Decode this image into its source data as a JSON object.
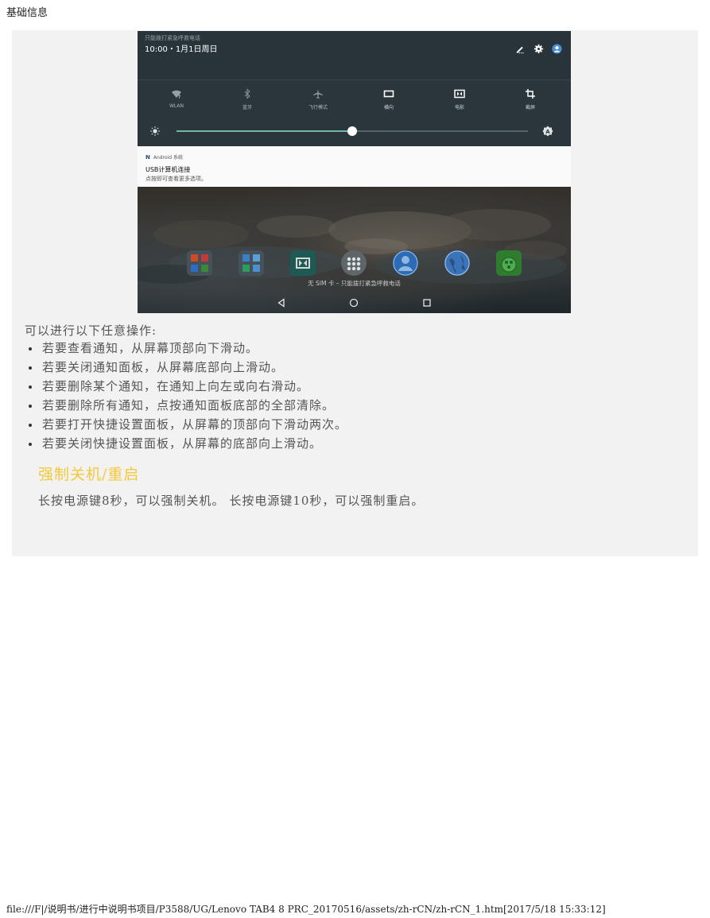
{
  "page_header": "基础信息",
  "screenshot": {
    "emergency_text": "只能拨打紧急呼救电话",
    "datetime": "10:00・1月1日周日",
    "top_icons": [
      "edit-icon",
      "gear-icon",
      "user-avatar-icon"
    ],
    "tiles": [
      {
        "label": "WLAN",
        "icon": "wifi-question-icon",
        "active": false
      },
      {
        "label": "蓝牙",
        "icon": "bluetooth-icon",
        "active": false
      },
      {
        "label": "飞行模式",
        "icon": "airplane-icon",
        "active": false
      },
      {
        "label": "横向",
        "icon": "landscape-icon",
        "active": true
      },
      {
        "label": "电影",
        "icon": "movie-icon",
        "active": true
      },
      {
        "label": "截屏",
        "icon": "crop-icon",
        "active": true
      }
    ],
    "brightness_level": 0.5,
    "notification": {
      "app": "Android 系统",
      "title": "USB计算机连接",
      "text": "点按即可查看更多选项。"
    },
    "dock_icons": [
      "office-folder-icon",
      "tools-folder-icon",
      "dolby-icon",
      "app-drawer-icon",
      "contacts-icon",
      "browser-icon",
      "security-icon"
    ],
    "sim_text": "无 SIM 卡 – 只能拨打紧急呼救电话",
    "nav_buttons": [
      "back-icon",
      "home-icon",
      "recents-icon"
    ],
    "colors": {
      "panel_dark": "#28343a",
      "slider_accent": "#6fb8a4"
    }
  },
  "intro": "可以进行以下任意操作:",
  "operations": [
    "若要查看通知，从屏幕顶部向下滑动。",
    "若要关闭通知面板，从屏幕底部向上滑动。",
    "若要删除某个通知，在通知上向左或向右滑动。",
    "若要删除所有通知，点按通知面板底部的全部清除。",
    "若要打开快捷设置面板，从屏幕的顶部向下滑动两次。",
    "若要关闭快捷设置面板，从屏幕的底部向上滑动。"
  ],
  "section": {
    "title": "强制关机/重启",
    "body": "长按电源键8秒，可以强制关机。 长按电源键10秒，可以强制重启。",
    "title_color": "#f4c93b"
  },
  "footer": "file:///F|/说明书/进行中说明书项目/P3588/UG/Lenovo TAB4 8 PRC_20170516/assets/zh-rCN/zh-rCN_1.htm[2017/5/18 15:33:12]"
}
